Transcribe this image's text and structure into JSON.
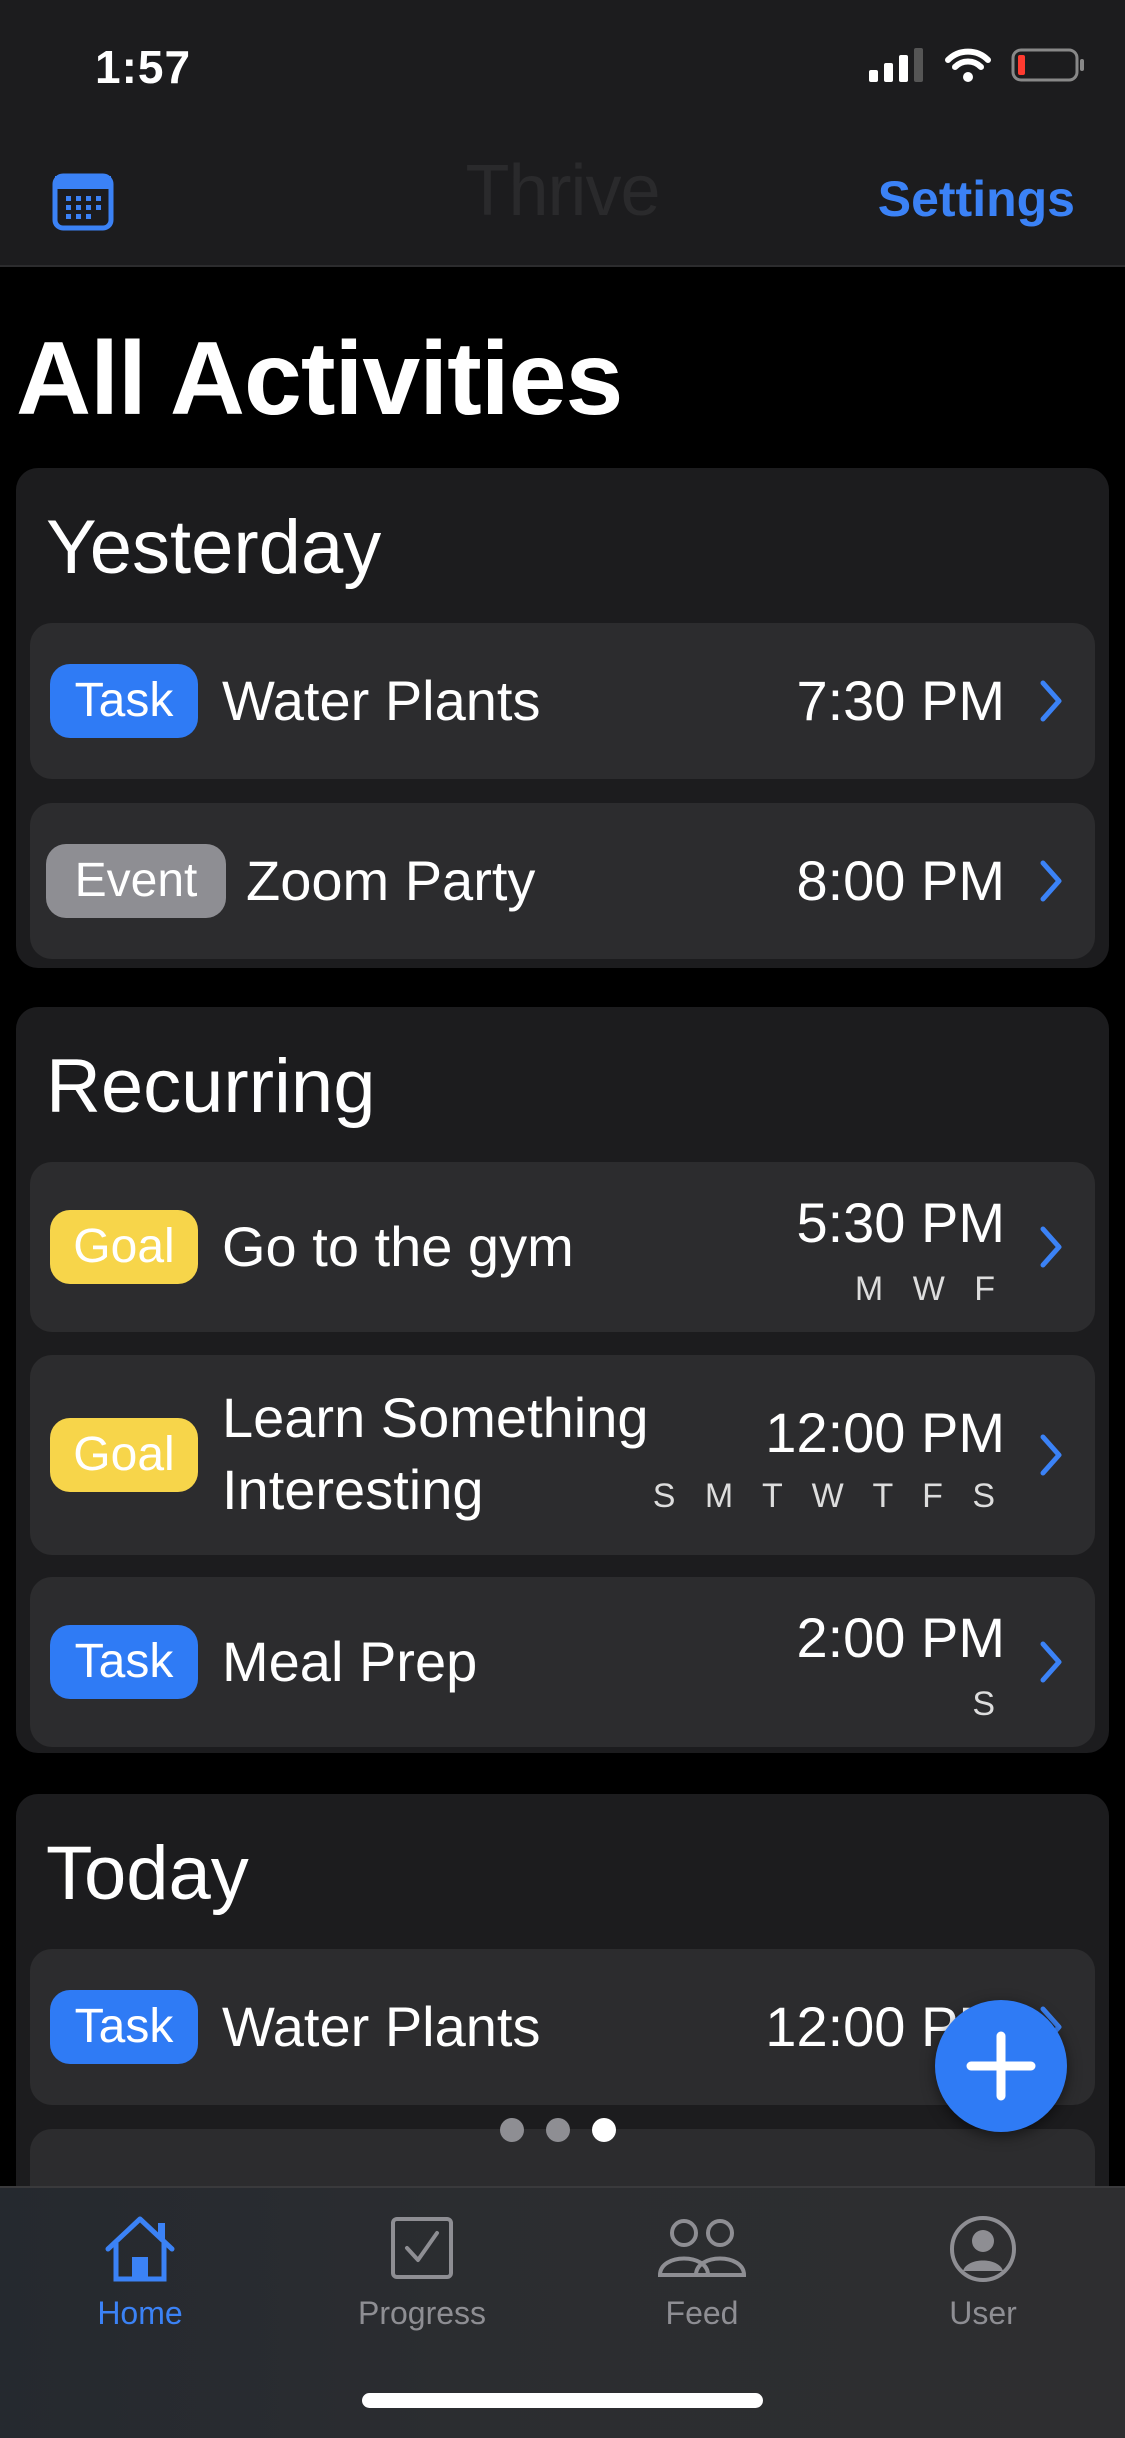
{
  "status_bar": {
    "time": "1:57"
  },
  "nav": {
    "title": "Thrive",
    "settings_label": "Settings"
  },
  "page_title": "All Activities",
  "sections": [
    {
      "title": "Yesterday",
      "rows": [
        {
          "badge": "Task",
          "name": "Water Plants",
          "time": "7:30 PM"
        },
        {
          "badge": "Event",
          "name": "Zoom Party",
          "time": "8:00 PM"
        }
      ]
    },
    {
      "title": "Recurring",
      "rows": [
        {
          "badge": "Goal",
          "name": "Go to the gym",
          "time": "5:30 PM",
          "days": "M W F"
        },
        {
          "badge": "Goal",
          "name_line1": "Learn Something",
          "name_line2": "Interesting",
          "time": "12:00 PM",
          "days": "S M T W T F S"
        },
        {
          "badge": "Task",
          "name": "Meal Prep",
          "time": "2:00 PM",
          "days": "S"
        }
      ]
    },
    {
      "title": "Today",
      "rows": [
        {
          "badge": "Task",
          "name": "Water Plants",
          "time": "12:00 PM"
        }
      ]
    }
  ],
  "tabs": [
    {
      "label": "Home",
      "icon": "house-icon"
    },
    {
      "label": "Progress",
      "icon": "checkbox-icon"
    },
    {
      "label": "Feed",
      "icon": "people-icon"
    },
    {
      "label": "User",
      "icon": "person-circle-icon"
    }
  ],
  "colors": {
    "accent": "#3b82f6",
    "task": "#2f7bf5",
    "event": "#8e8e93",
    "goal": "#f7d54a"
  }
}
